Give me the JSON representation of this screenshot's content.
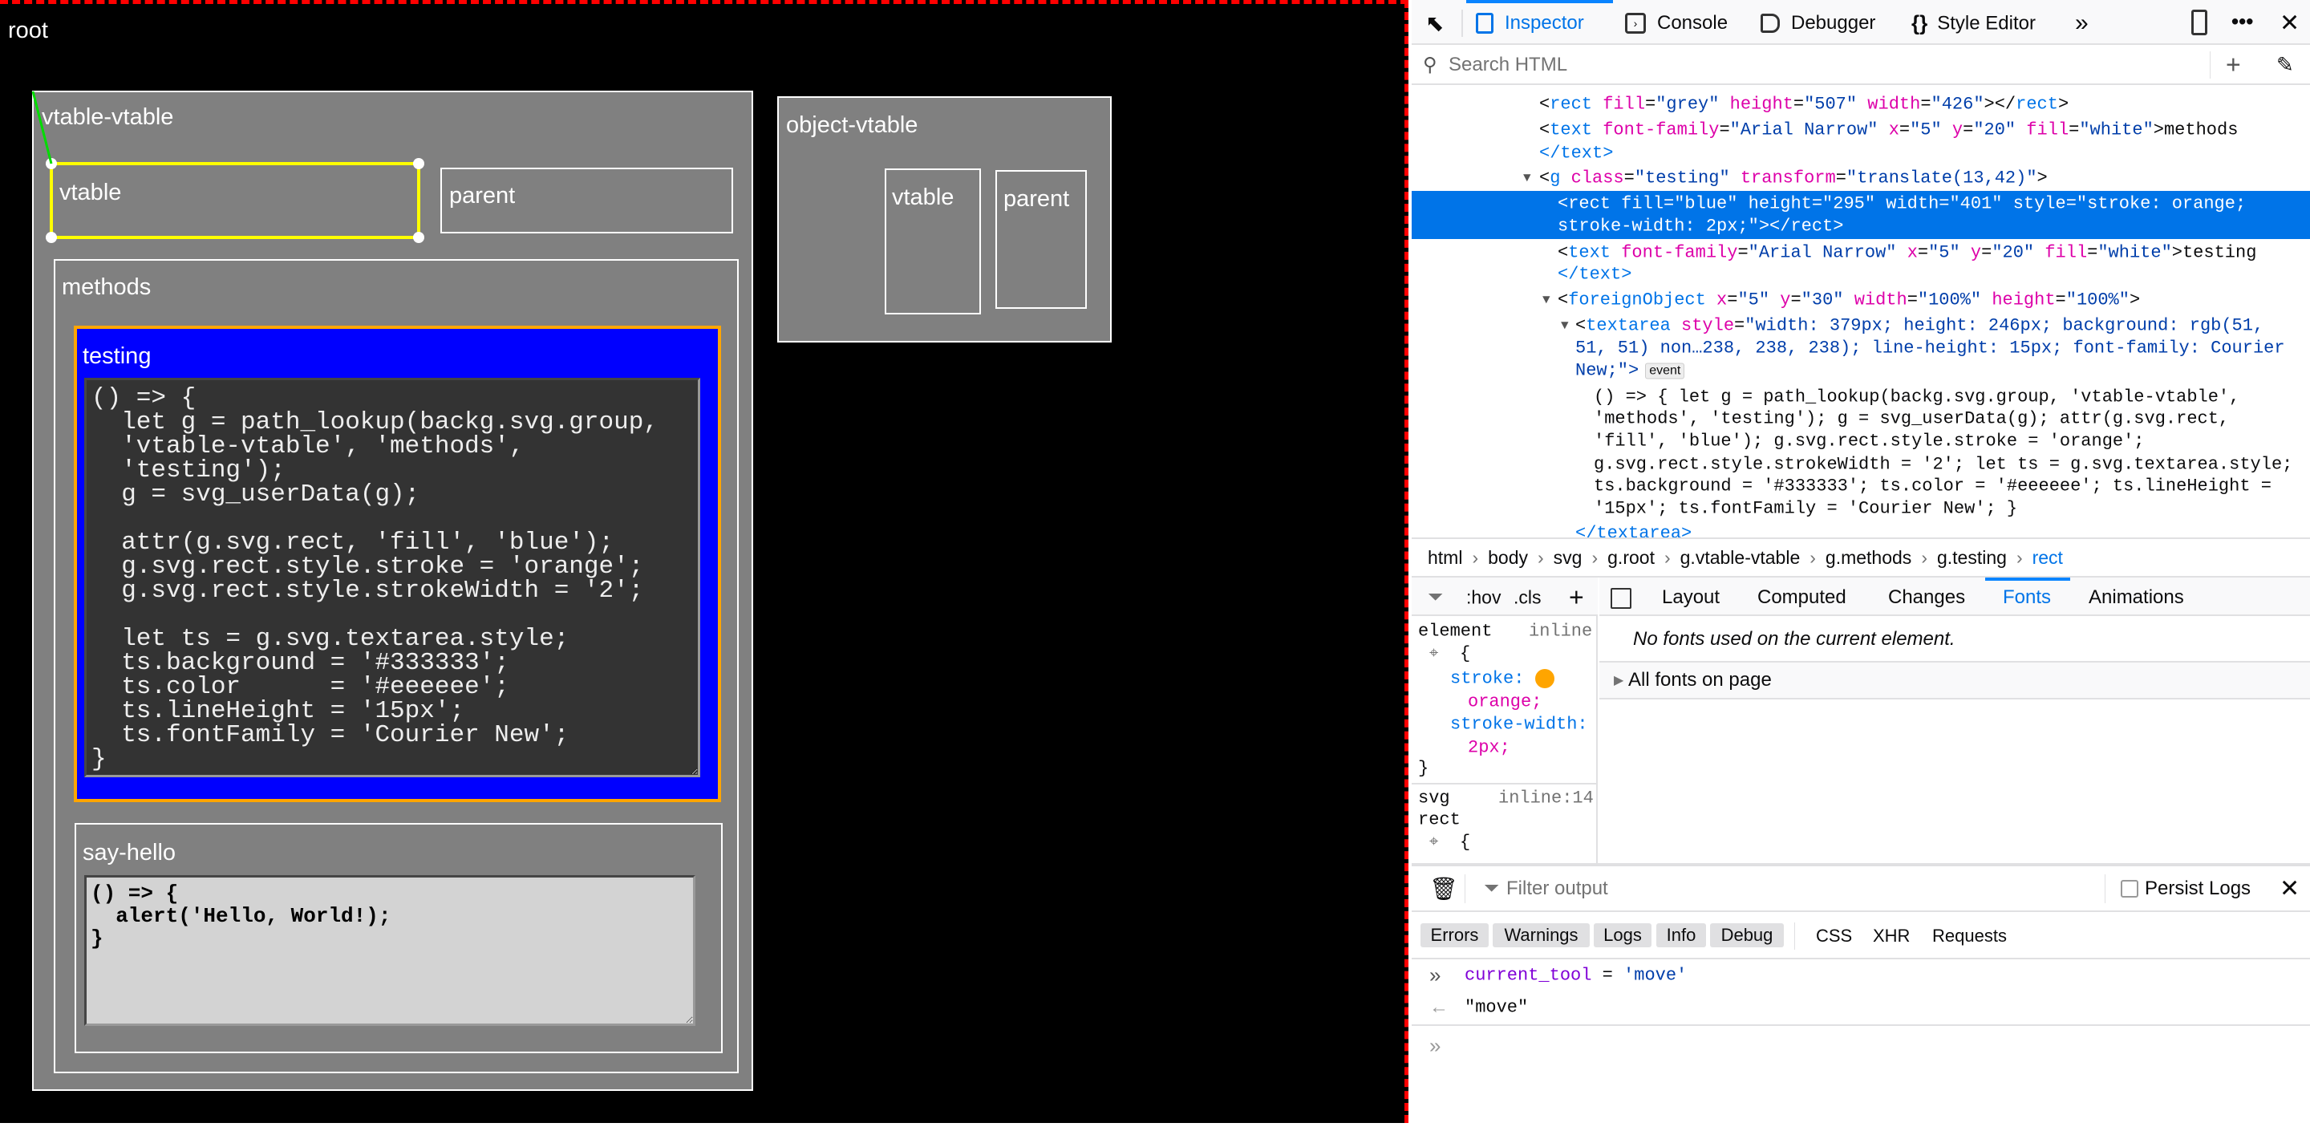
{
  "canvas": {
    "root_label": "root",
    "vtable_vtable": {
      "label": "vtable-vtable",
      "vtable_label": "vtable",
      "parent_label": "parent"
    },
    "methods_label": "methods",
    "testing": {
      "label": "testing",
      "code": "() => {\n  let g = path_lookup(backg.svg.group,\n  'vtable-vtable', 'methods',\n  'testing');\n  g = svg_userData(g);\n\n  attr(g.svg.rect, 'fill', 'blue');\n  g.svg.rect.style.stroke = 'orange';\n  g.svg.rect.style.strokeWidth = '2';\n\n  let ts = g.svg.textarea.style;\n  ts.background = '#333333';\n  ts.color      = '#eeeeee';\n  ts.lineHeight = '15px';\n  ts.fontFamily = 'Courier New';\n}"
    },
    "say_hello": {
      "label": "say-hello",
      "code": "() => {\n  alert('Hello, World!);\n}"
    },
    "object_vtable": {
      "label": "object-vtable",
      "vtable_label": "vtable",
      "parent_label": "parent"
    },
    "colors": {
      "selection": "#ffff00",
      "connector": "#00dd00",
      "testing_fill": "#0000ff",
      "testing_stroke": "#ffa500"
    }
  },
  "devtools": {
    "tabs": [
      "Inspector",
      "Console",
      "Debugger",
      "Style Editor"
    ],
    "active_tab": "Inspector",
    "search_placeholder": "Search HTML",
    "markup": {
      "l1": [
        "rect",
        "fill",
        "\"grey\"",
        "height",
        "\"507\"",
        "width",
        "\"426\"",
        "></",
        "rect",
        ">"
      ],
      "l2": [
        "text",
        "font-family",
        "\"Arial Narrow\"",
        "x",
        "\"5\"",
        "y",
        "\"20\"",
        "fill",
        "\"white\"",
        ">methods"
      ],
      "l3": "</text>",
      "l4": [
        "g",
        "class",
        "\"testing\"",
        "transform",
        "\"translate(13,42)\"",
        ">"
      ],
      "sel1": "<rect fill=\"blue\" height=\"295\" width=\"401\" style=\"stroke: orange;",
      "sel2": "stroke-width: 2px;\"></rect>",
      "l5": [
        "text",
        "font-family",
        "\"Arial Narrow\"",
        "x",
        "\"5\"",
        "y",
        "\"20\"",
        "fill",
        "\"white\"",
        ">testing"
      ],
      "l6": "</text>",
      "l7": [
        "foreignObject",
        "x",
        "\"5\"",
        "y",
        "\"30\"",
        "width",
        "\"100%\"",
        "height",
        "\"100%\"",
        ">"
      ],
      "l8a": [
        "textarea",
        "style",
        "\"width: 379px; height: 246px; background: rgb(51,"
      ],
      "l8b": "51, 51) non…238, 238, 238); line-height: 15px; font-family: Courier",
      "l8c": "New;\">",
      "event_badge": "event",
      "code": [
        "() => { let g = path_lookup(backg.svg.group, 'vtable-vtable',",
        "'methods', 'testing'); g = svg_userData(g); attr(g.svg.rect,",
        "'fill', 'blue'); g.svg.rect.style.stroke = 'orange';",
        "g.svg.rect.style.strokeWidth = '2'; let ts = g.svg.textarea.style;",
        "ts.background = '#333333'; ts.color = '#eeeeee'; ts.lineHeight =",
        "'15px'; ts.fontFamily = 'Courier New'; }"
      ],
      "close": "</textarea>"
    },
    "breadcrumbs": [
      "html",
      "body",
      "svg",
      "g.root",
      "g.vtable-vtable",
      "g.methods",
      "g.testing",
      "rect"
    ],
    "rules": {
      "hov": ":hov",
      "cls": ".cls",
      "element": "element",
      "element_src": "inline",
      "prop1": "stroke:",
      "val1": "orange;",
      "prop2": "stroke-width:",
      "val2": "2px;",
      "brace_open": "{",
      "brace_close": "}",
      "svg_sel": "svg",
      "svg_src": "inline:14",
      "rect_sel": "rect"
    },
    "side_tabs": [
      "Layout",
      "Computed",
      "Changes",
      "Fonts",
      "Animations"
    ],
    "active_side_tab": "Fonts",
    "fonts": {
      "empty": "No fonts used on the current element.",
      "all": "All fonts on page"
    },
    "console": {
      "filter_placeholder": "Filter output",
      "persist_logs": "Persist Logs",
      "filters": [
        "Errors",
        "Warnings",
        "Logs",
        "Info",
        "Debug"
      ],
      "filters2": [
        "CSS",
        "XHR",
        "Requests"
      ],
      "input_var": "current_tool",
      "input_op": " = ",
      "input_val": "'move'",
      "output": "\"move\""
    }
  }
}
